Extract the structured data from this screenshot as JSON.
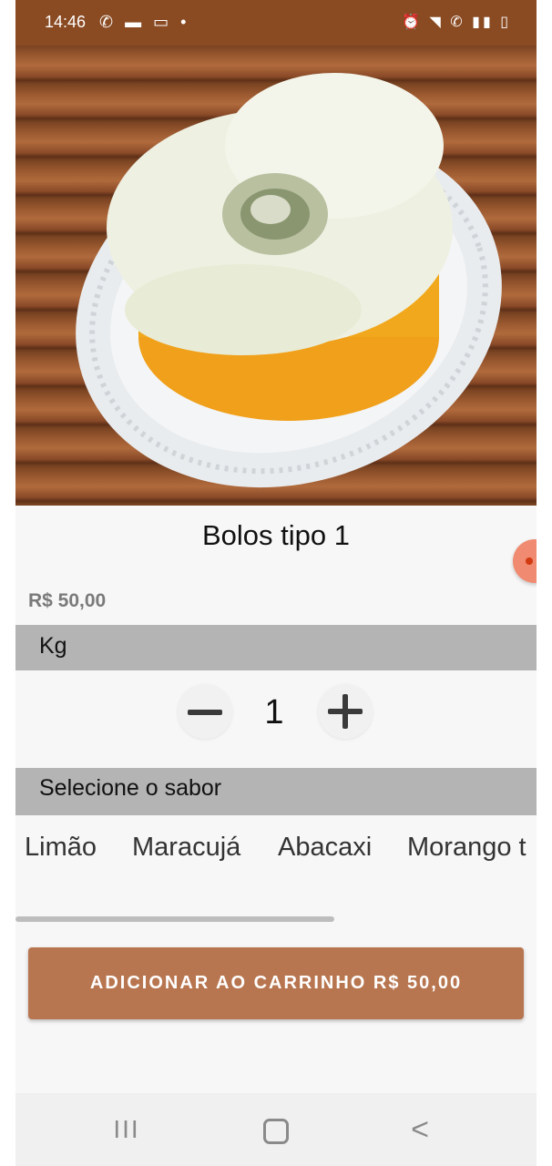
{
  "status_bar": {
    "time": "14:46",
    "left_icons": "✆ ▬ ▭ •",
    "right_icons": "⏰ ◥ ✆ ▮▮ ▯"
  },
  "product": {
    "title": "Bolos tipo 1",
    "price": "R$ 50,00",
    "image_icon": "cake-photo"
  },
  "unit_section": {
    "label": "Kg"
  },
  "quantity": {
    "value": "1",
    "minus_icon": "minus-icon",
    "plus_icon": "plus-icon"
  },
  "flavor_section": {
    "label": "Selecione o sabor"
  },
  "flavors": [
    "Limão",
    "Maracujá",
    "Abacaxi",
    "Morango t"
  ],
  "cta": {
    "label": "ADICIONAR AO CARRINHO R$ 50,00"
  },
  "nav": {
    "recent": "III",
    "back": "<"
  },
  "colors": {
    "status_bar": "#8a4a22",
    "accent_button": "#b87650",
    "section_bar": "#b4b4b4",
    "fab": "#f08a70"
  }
}
